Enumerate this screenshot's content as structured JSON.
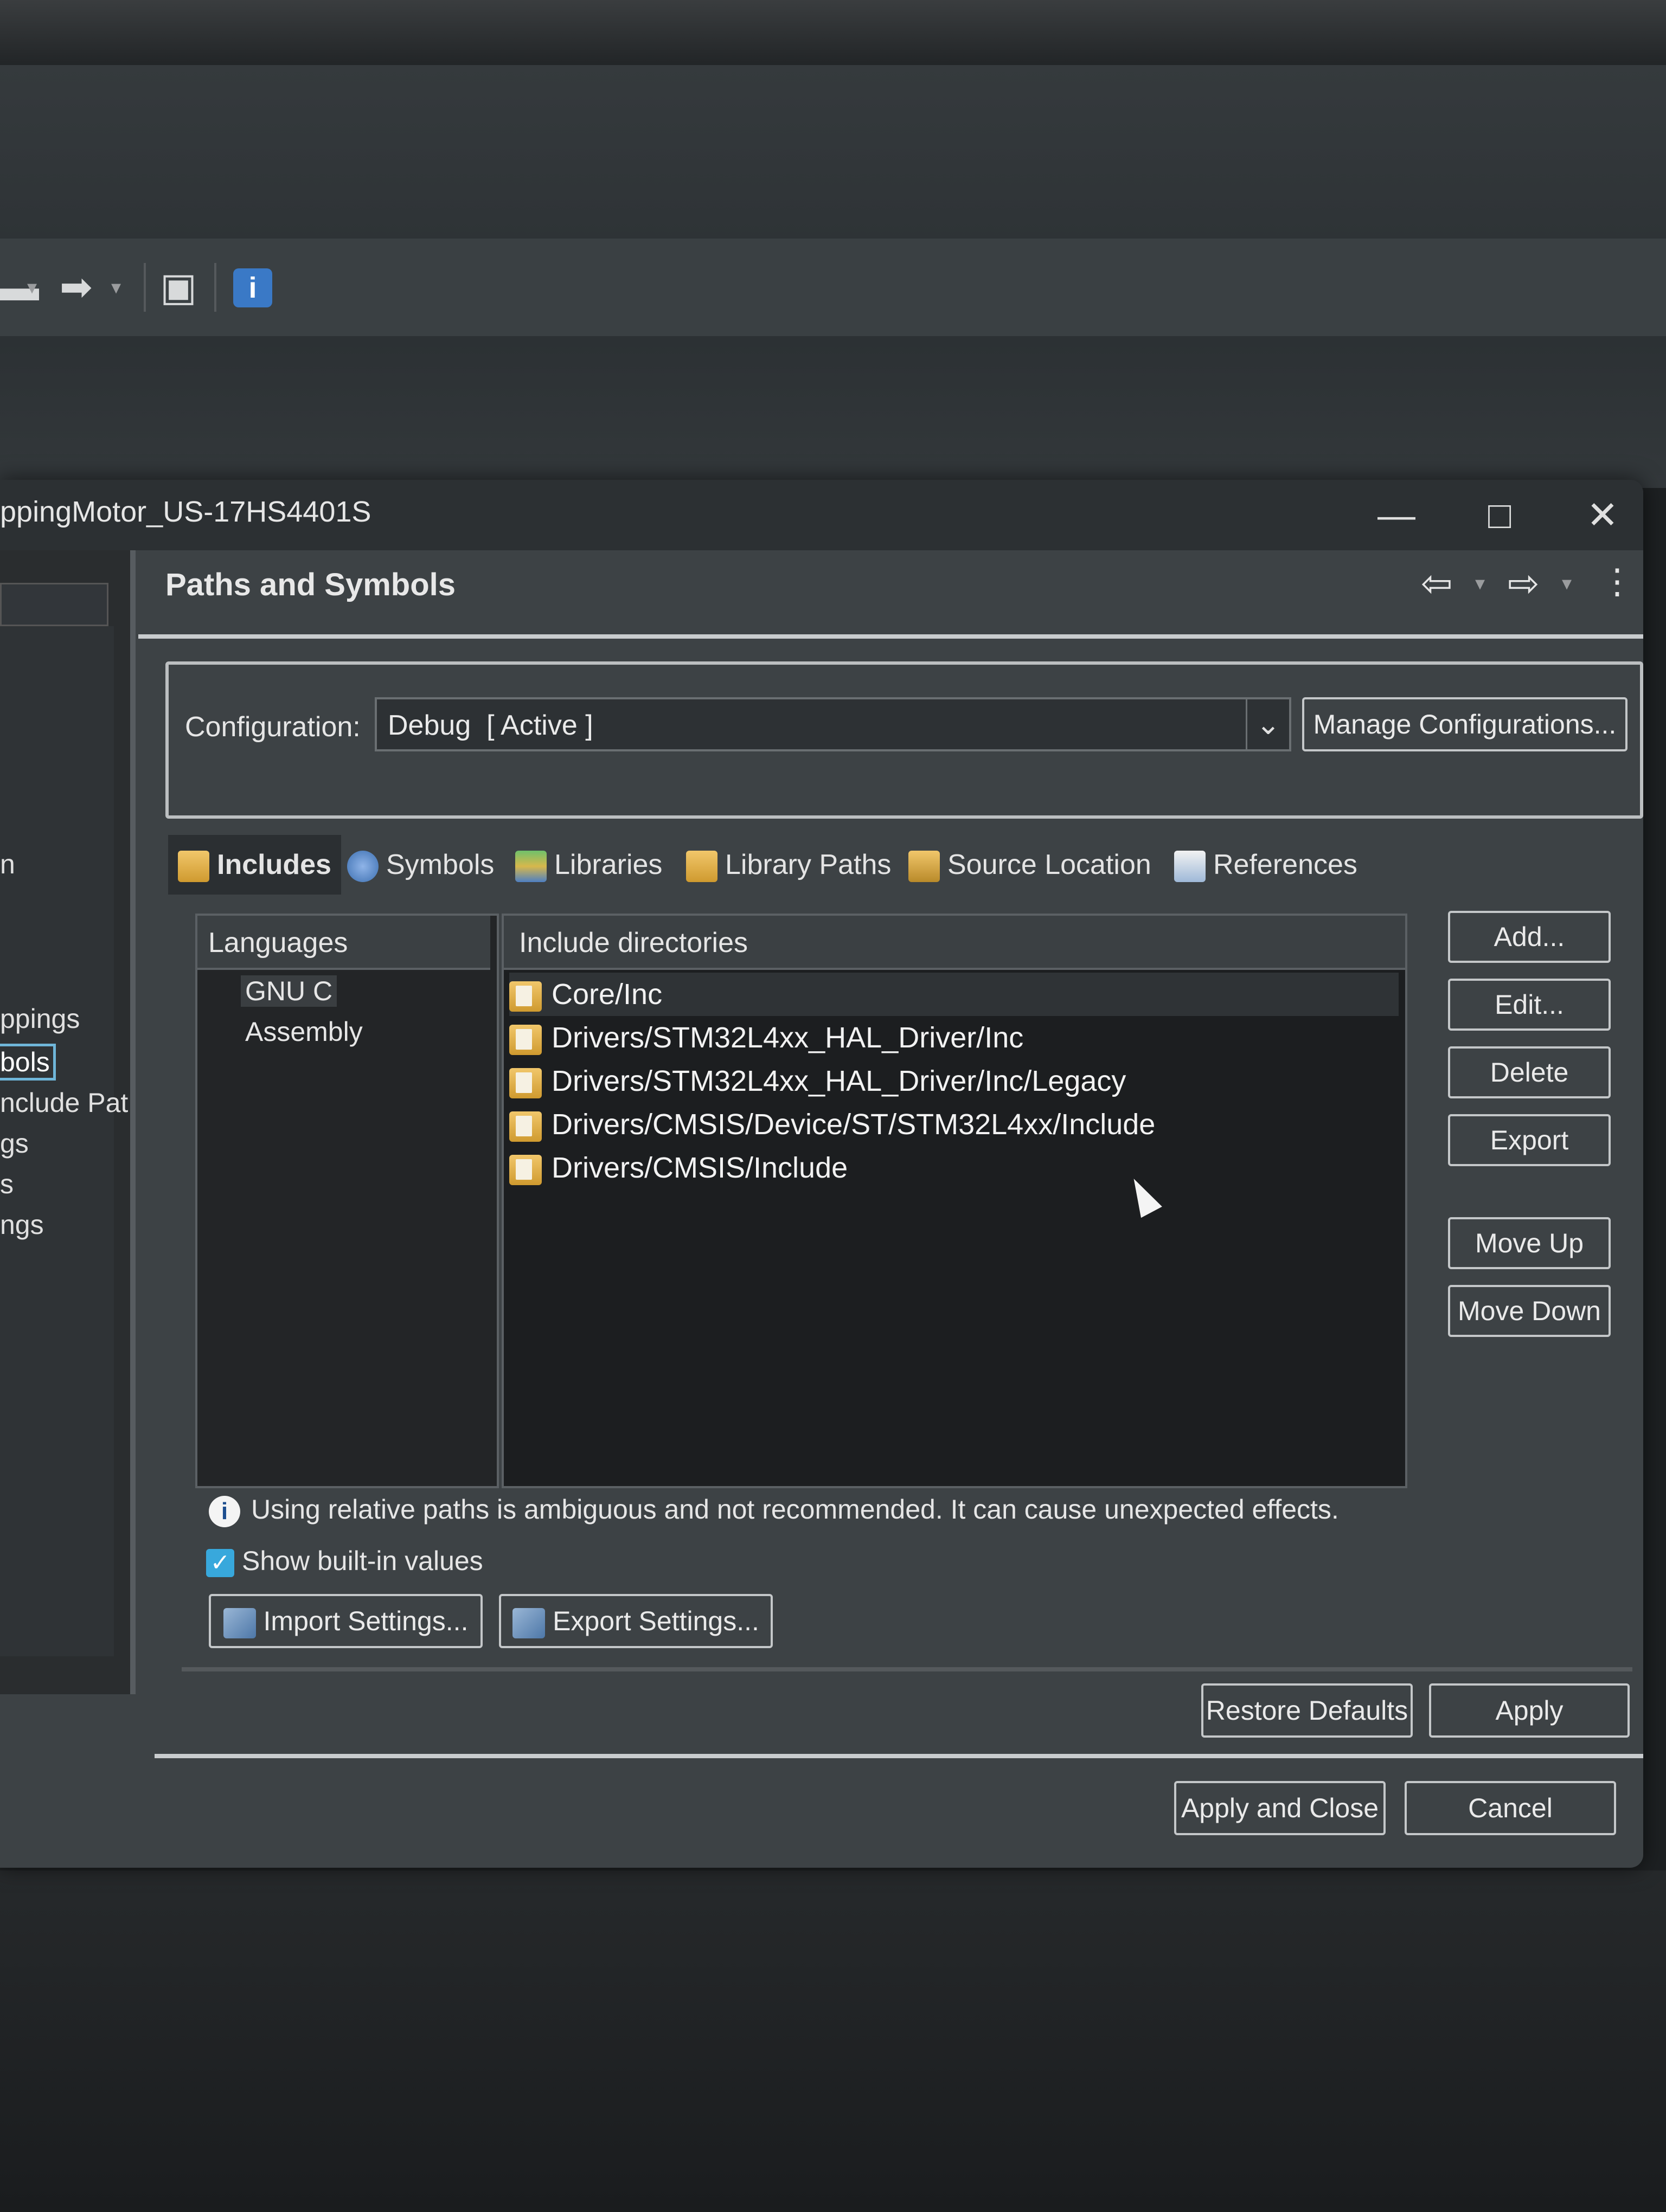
{
  "toolbar": {
    "back_icon": "arrow-right-icon",
    "info_icon_glyph": "i"
  },
  "dialog": {
    "title": "ppingMotor_US-17HS4401S",
    "window_buttons": {
      "minimize": "—",
      "maximize": "□",
      "close": "✕"
    }
  },
  "left_tree": {
    "items": [
      "n",
      "ppings",
      "bols",
      "nclude Pat",
      "gs",
      "s",
      "ngs"
    ],
    "selected_index": 2
  },
  "page": {
    "title": "Paths and Symbols",
    "nav": {
      "back": "⇦",
      "forward": "⇨",
      "menu": "⋮"
    }
  },
  "configuration": {
    "label": "Configuration:",
    "value": "Debug  [ Active ]",
    "manage_button": "Manage Configurations..."
  },
  "tabs": [
    {
      "label": "Includes",
      "icon": "includes-icon",
      "selected": true
    },
    {
      "label": "Symbols",
      "icon": "symbols-icon"
    },
    {
      "label": "Libraries",
      "icon": "libraries-icon"
    },
    {
      "label": "Library Paths",
      "icon": "library-paths-icon"
    },
    {
      "label": "Source Location",
      "icon": "source-location-icon"
    },
    {
      "label": "References",
      "icon": "references-icon"
    }
  ],
  "languages": {
    "header": "Languages",
    "items": [
      "GNU C",
      "Assembly"
    ],
    "selected": "GNU C"
  },
  "include_dirs": {
    "header": "Include directories",
    "rows": [
      "Core/Inc",
      "Drivers/STM32L4xx_HAL_Driver/Inc",
      "Drivers/STM32L4xx_HAL_Driver/Inc/Legacy",
      "Drivers/CMSIS/Device/ST/STM32L4xx/Include",
      "Drivers/CMSIS/Include"
    ]
  },
  "side_buttons": {
    "add": "Add...",
    "edit": "Edit...",
    "delete": "Delete",
    "export": "Export",
    "move_up": "Move Up",
    "move_down": "Move Down"
  },
  "info_message": "Using relative paths is ambiguous and not recommended. It can cause unexpected effects.",
  "show_builtin": {
    "label": "Show built-in values",
    "checked": true
  },
  "settings_buttons": {
    "import": "Import Settings...",
    "export": "Export Settings..."
  },
  "footer": {
    "restore_defaults": "Restore Defaults",
    "apply": "Apply",
    "apply_and_close": "Apply and Close",
    "cancel": "Cancel"
  },
  "colors": {
    "dialog_bg": "#3d4245",
    "checkbox_accent": "#38a8dc",
    "selection_border": "#6fb6d9"
  }
}
